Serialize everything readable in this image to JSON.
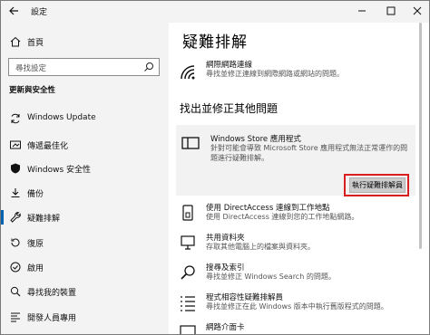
{
  "window": {
    "title": "設定",
    "back_icon": "arrow-left",
    "minimize_icon": "minimize",
    "maximize_icon": "maximize",
    "close_icon": "close"
  },
  "sidebar": {
    "home_label": "首頁",
    "search_placeholder": "尋找設定",
    "section_title": "更新與安全性",
    "items": [
      {
        "label": "Windows Update",
        "icon": "sync-icon"
      },
      {
        "label": "傳遞最佳化",
        "icon": "delivery-optimization-icon"
      },
      {
        "label": "Windows 安全性",
        "icon": "shield-icon"
      },
      {
        "label": "備份",
        "icon": "backup-icon"
      },
      {
        "label": "疑難排解",
        "icon": "wrench-icon",
        "active": true
      },
      {
        "label": "復原",
        "icon": "recovery-icon"
      },
      {
        "label": "啟用",
        "icon": "activation-icon"
      },
      {
        "label": "尋找我的裝置",
        "icon": "find-device-icon"
      },
      {
        "label": "開發人員專用",
        "icon": "developer-icon"
      }
    ]
  },
  "main": {
    "title": "疑難排解",
    "top_item": {
      "name": "網際網路連線",
      "desc": "尋找並修正連線到網際網路或網站的問題。"
    },
    "section_title": "找出並修正其他問題",
    "expanded": {
      "name": "Windows Store 應用程式",
      "desc": "針對可能會導致 Microsoft Store 應用程式無法正常運作的問題進行疑難排解。",
      "button_label": "執行疑難排解員"
    },
    "items": [
      {
        "name": "使用 DirectAccess 連線到工作地點",
        "desc": "使用 DirectAccess 連線到您的工作地點網路。",
        "icon": "directaccess-icon"
      },
      {
        "name": "共用資料夾",
        "desc": "存取其他電腦上的檔案與資料夾。",
        "icon": "shared-folder-icon"
      },
      {
        "name": "搜尋及索引",
        "desc": "尋找並修正 Windows Search 的問題。",
        "icon": "search-index-icon"
      },
      {
        "name": "程式相容性疑難排解員",
        "desc": "尋找並修正在此 Windows 版本中執行舊版程式的問題。",
        "icon": "program-compat-icon"
      },
      {
        "name": "網路介面卡",
        "desc": "",
        "icon": "network-adapter-icon"
      }
    ]
  },
  "colors": {
    "accent": "#0063b1",
    "highlight": "#d81e1e",
    "sidebar_bg": "#f3f3f3",
    "card_bg": "#f2f2f2"
  }
}
